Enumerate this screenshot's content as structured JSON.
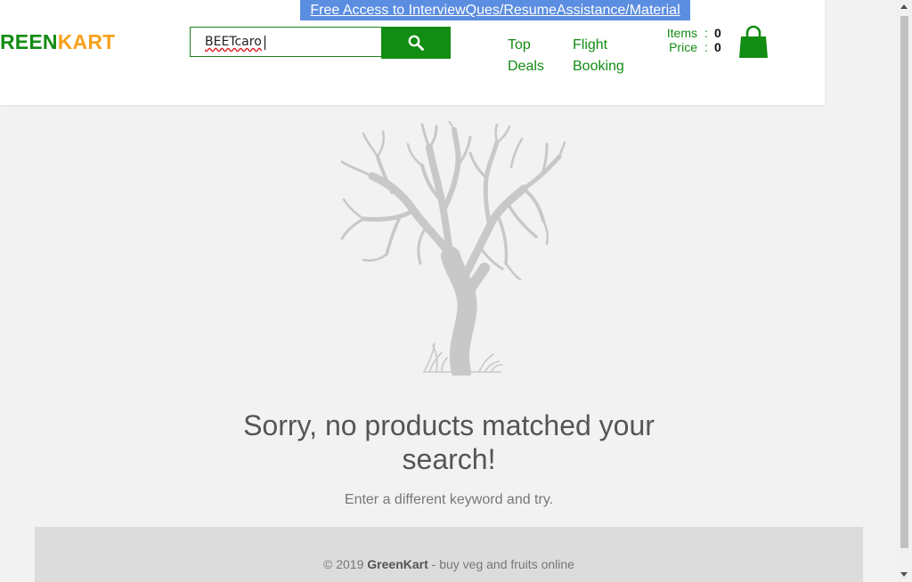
{
  "banner": {
    "text": "Free Access to InterviewQues/ResumeAssistance/Material"
  },
  "brand": {
    "part_green": "REEN",
    "part_orange": "KART"
  },
  "search": {
    "value": "BEETcaro",
    "button_icon": "search-icon"
  },
  "nav": {
    "top_deals": [
      "Top",
      "Deals"
    ],
    "flight_booking": [
      "Flight",
      "Booking"
    ]
  },
  "cart": {
    "items_label": "Items",
    "items_value": "0",
    "price_label": "Price",
    "price_value": "0",
    "colon": ":",
    "icon": "shopping-bag-icon"
  },
  "empty_state": {
    "illustration": "bare-tree",
    "title": "Sorry, no products matched your search!",
    "subtitle": "Enter a different keyword and try."
  },
  "footer": {
    "copyright": "© 2019 ",
    "brand": "GreenKart",
    "tagline": " - buy veg and fruits online"
  },
  "colors": {
    "brand_green": "#128c12",
    "brand_orange": "#f7a11a",
    "banner_blue": "#5b8de0",
    "tree_gray": "#c8c8c8",
    "page_bg": "#f2f2f2"
  }
}
